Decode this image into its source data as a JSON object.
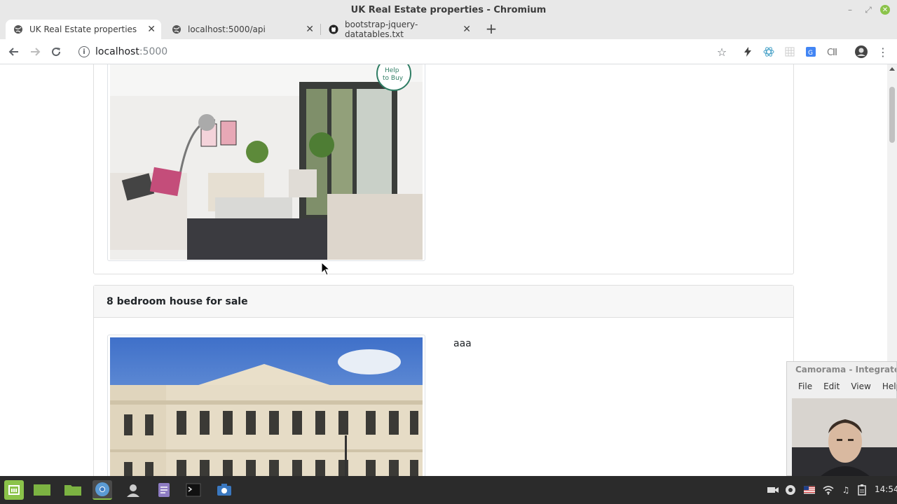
{
  "window": {
    "title": "UK Real Estate properties - Chromium"
  },
  "tabs": [
    {
      "label": "UK Real Estate properties",
      "active": true,
      "icon": "globe-icon"
    },
    {
      "label": "localhost:5000/api",
      "active": false,
      "icon": "globe-icon"
    },
    {
      "label": "bootstrap-jquery-datatables.txt",
      "active": false,
      "icon": "github-icon"
    }
  ],
  "address": {
    "host": "localhost",
    "port": ":5000"
  },
  "listings": [
    {
      "title": "",
      "description": "",
      "badge": "Help to Buy"
    },
    {
      "title": "8 bedroom house for sale",
      "description": "aaa"
    }
  ],
  "camorama": {
    "title": "Camorama - Integrated",
    "menu": [
      "File",
      "Edit",
      "View",
      "Help"
    ]
  },
  "taskbar": {
    "clock": "14:54"
  }
}
